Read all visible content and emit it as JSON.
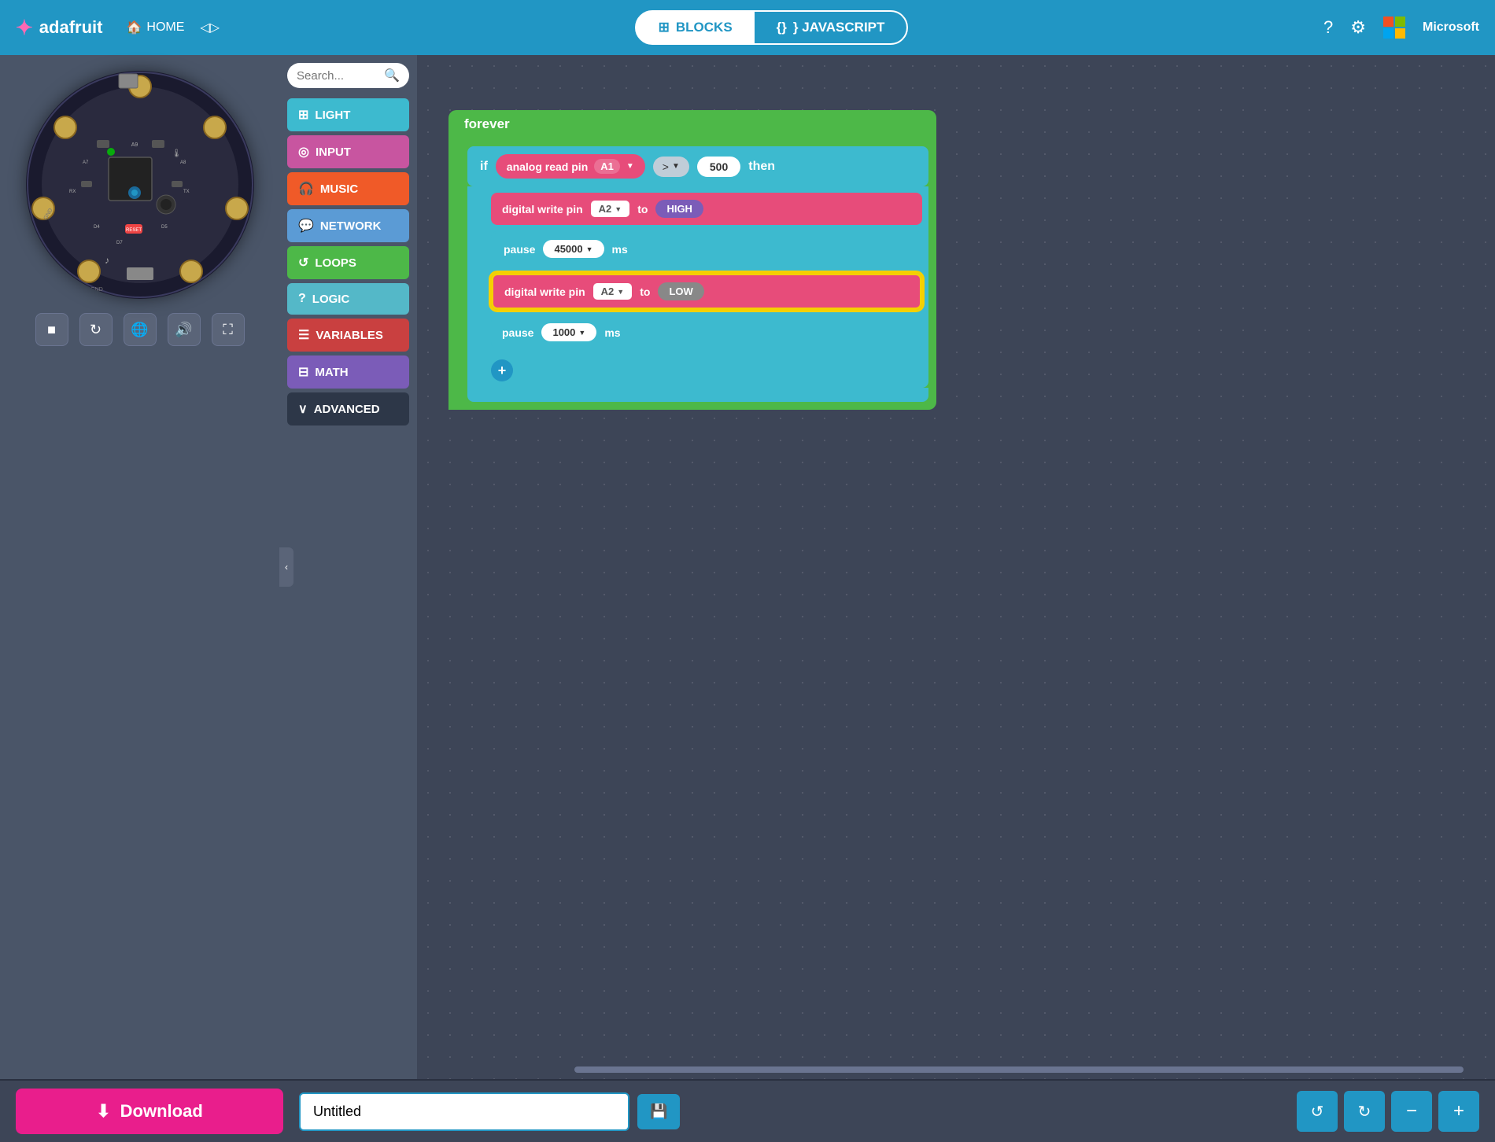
{
  "header": {
    "logo_text": "adafruit",
    "nav_home": "HOME",
    "blocks_label": "BLOCKS",
    "javascript_label": "} JAVASCRIPT",
    "help_icon": "?",
    "settings_icon": "⚙"
  },
  "sidebar": {
    "search_placeholder": "Search...",
    "categories": [
      {
        "id": "light",
        "label": "LIGHT",
        "color": "#3dbacf",
        "icon": "⊞"
      },
      {
        "id": "input",
        "label": "INPUT",
        "color": "#c855a0",
        "icon": "◎"
      },
      {
        "id": "music",
        "label": "MUSIC",
        "color": "#f05a28",
        "icon": "🎧"
      },
      {
        "id": "network",
        "label": "NETWORK",
        "color": "#5b9bd5",
        "icon": "💬"
      },
      {
        "id": "loops",
        "label": "LOOPS",
        "color": "#4db848",
        "icon": "↺"
      },
      {
        "id": "logic",
        "label": "LOGIC",
        "color": "#54b8c8",
        "icon": "?"
      },
      {
        "id": "variables",
        "label": "VARIABLES",
        "color": "#c94040",
        "icon": "☰"
      },
      {
        "id": "math",
        "label": "MATH",
        "color": "#7b5cb8",
        "icon": "⊟"
      },
      {
        "id": "advanced",
        "label": "ADVANCED",
        "color": "#2d3748",
        "icon": "∨"
      }
    ]
  },
  "workspace": {
    "forever_label": "forever",
    "if_label": "if",
    "analog_read_label": "analog read pin",
    "pin_a1": "A1",
    "operator": ">",
    "value_500": "500",
    "then_label": "then",
    "digital_write_label": "digital write pin",
    "pin_a2_1": "A2",
    "to_label": "to",
    "high_label": "HIGH",
    "pause_label": "pause",
    "pause_val_1": "45000",
    "ms_label": "ms",
    "pin_a2_2": "A2",
    "low_label": "LOW",
    "pause_val_2": "1000"
  },
  "bottom": {
    "download_label": "Download",
    "project_name": "Untitled",
    "save_icon": "💾",
    "undo_icon": "↺",
    "redo_icon": "↻",
    "zoom_out": "−",
    "zoom_in": "+"
  }
}
